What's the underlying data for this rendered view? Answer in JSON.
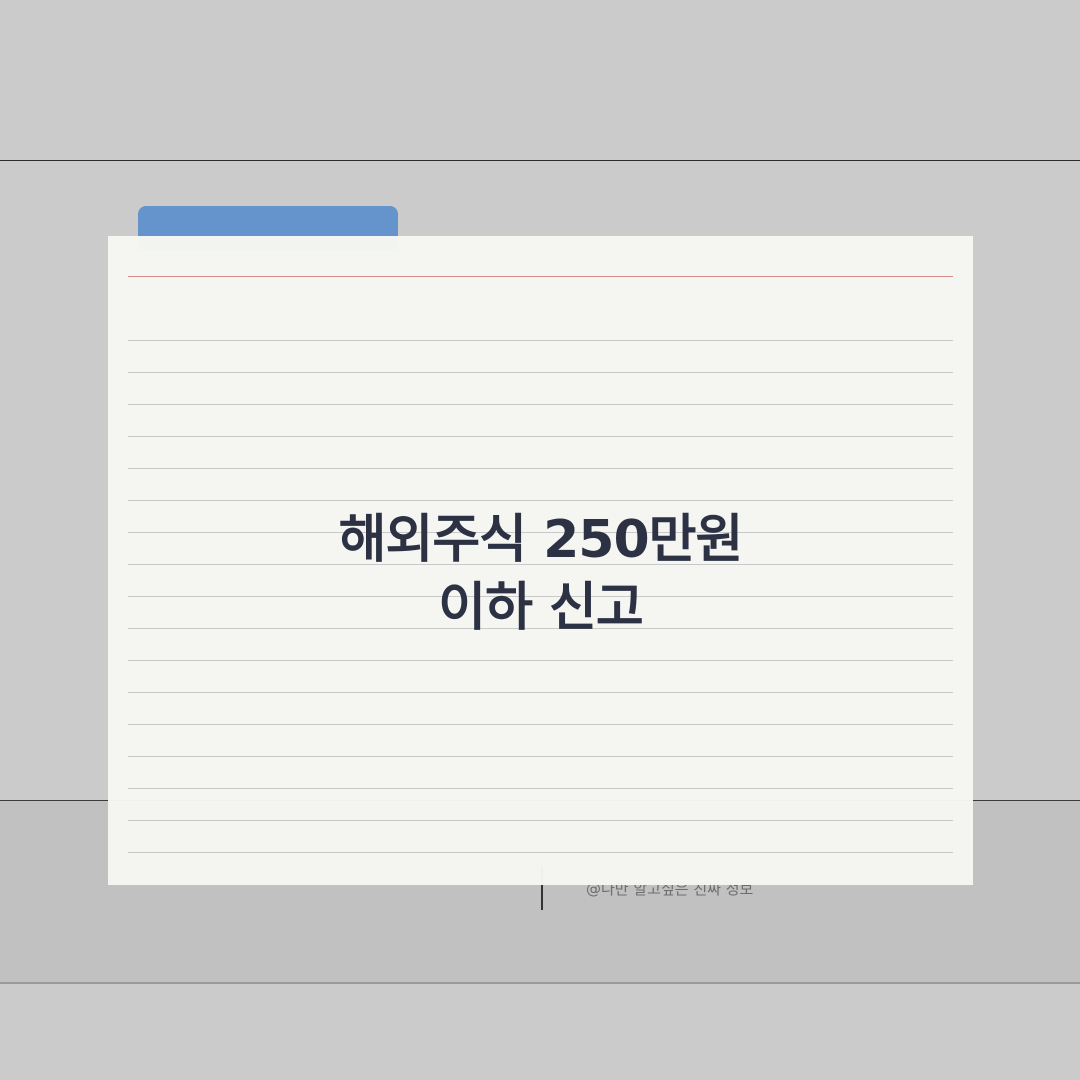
{
  "card": {
    "title_line1": "해외주식 250만원",
    "title_line2": "이하 신고"
  },
  "footer": {
    "credit": "@나만 알고싶은 진짜 정보"
  },
  "colors": {
    "background": "#cbcbcb",
    "tab": "#6593cb",
    "card": "#f7f8f3",
    "margin_line": "#d98a86",
    "title_text": "#262b3f"
  }
}
